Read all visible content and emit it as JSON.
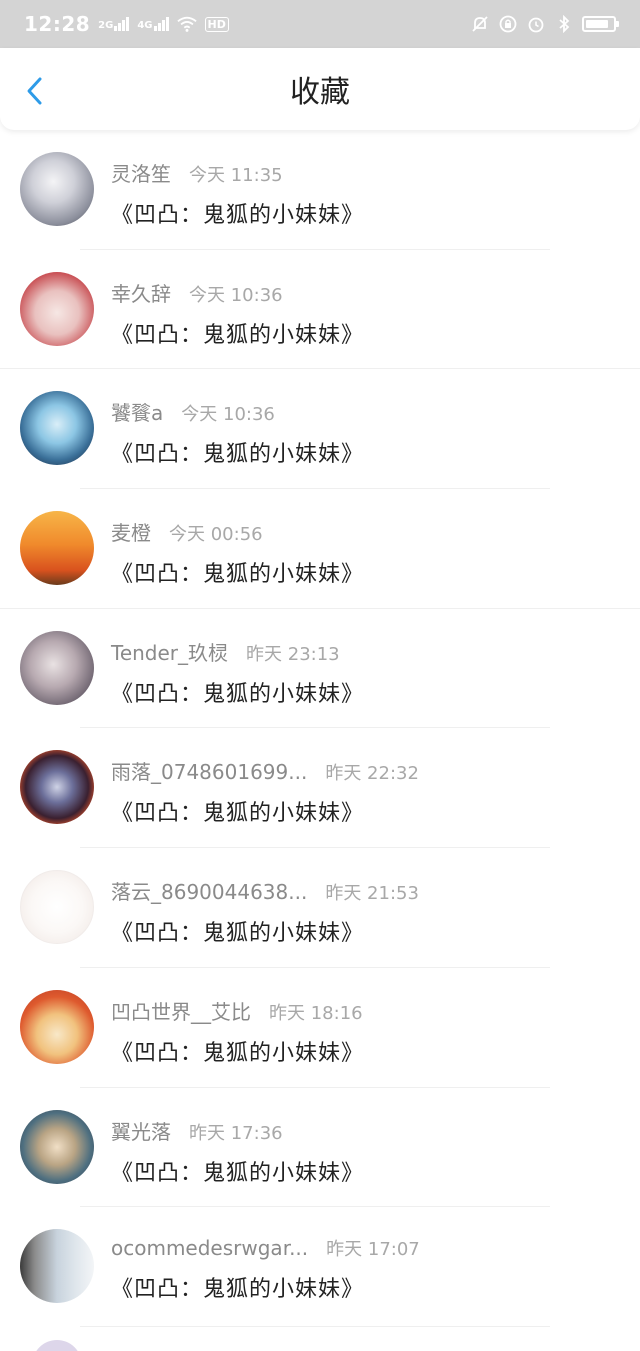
{
  "status_bar": {
    "time": "12:28",
    "net1": "2G",
    "net2": "4G",
    "hd": "HD",
    "icons": [
      "signal-icon",
      "wifi-icon",
      "bell-muted-icon",
      "lock-rotation-icon",
      "alarm-icon",
      "bluetooth-icon",
      "battery-icon"
    ]
  },
  "header": {
    "title": "收藏",
    "back_icon": "chevron-left-icon",
    "accent_color": "#2e9be8"
  },
  "items": [
    {
      "user": "灵洛笙",
      "time": "今天 11:35",
      "title": "《凹凸：鬼狐的小妹妹》"
    },
    {
      "user": "幸久辞",
      "time": "今天 10:36",
      "title": "《凹凸：鬼狐的小妹妹》"
    },
    {
      "user": "饕餮a",
      "time": "今天 10:36",
      "title": "《凹凸：鬼狐的小妹妹》"
    },
    {
      "user": "麦橙",
      "time": "今天 00:56",
      "title": "《凹凸：鬼狐的小妹妹》"
    },
    {
      "user": "Tender_玖棂",
      "time": "昨天 23:13",
      "title": "《凹凸：鬼狐的小妹妹》"
    },
    {
      "user": "雨落_0748601699...",
      "time": "昨天 22:32",
      "title": "《凹凸：鬼狐的小妹妹》"
    },
    {
      "user": "落云_8690044638...",
      "time": "昨天 21:53",
      "title": "《凹凸：鬼狐的小妹妹》"
    },
    {
      "user": "凹凸世界__艾比",
      "time": "昨天 18:16",
      "title": "《凹凸：鬼狐的小妹妹》"
    },
    {
      "user": "翼光落",
      "time": "昨天 17:36",
      "title": "《凹凸：鬼狐的小妹妹》"
    },
    {
      "user": "ocommedesrwgar...",
      "time": "昨天 17:07",
      "title": "《凹凸：鬼狐的小妹妹》"
    }
  ]
}
